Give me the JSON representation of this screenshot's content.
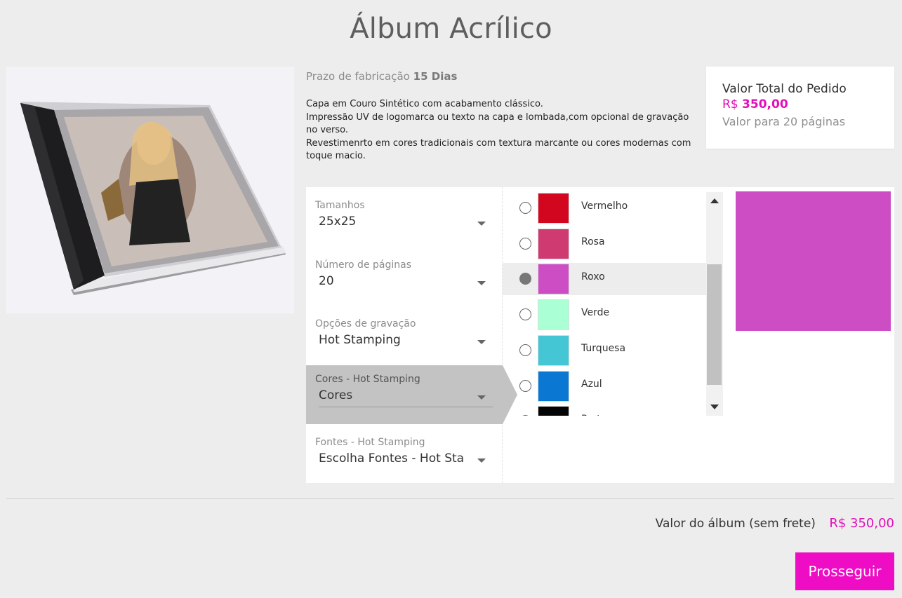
{
  "page": {
    "title": "Álbum Acrílico"
  },
  "info": {
    "prazo_label": "Prazo de fabricação",
    "prazo_value": "15 Dias",
    "description_lines": [
      "Capa em Couro Sintético com acabamento clássico.",
      "Impressão UV de logomarca ou texto na capa e lombada,com opcional de gravação no verso.",
      "Revestimenrto em cores tradicionais com textura marcante ou cores modernas com toque macio."
    ]
  },
  "total": {
    "label": "Valor Total do Pedido",
    "currency": "R$",
    "amount": "350,00",
    "sub": "Valor para 20 páginas"
  },
  "options": [
    {
      "label": "Tamanhos",
      "value": "25x25"
    },
    {
      "label": "Número de páginas",
      "value": "20"
    },
    {
      "label": "Opções de gravação",
      "value": "Hot Stamping"
    },
    {
      "label": "Cores - Hot Stamping",
      "value": "Cores"
    },
    {
      "label": "Fontes - Hot Stamping",
      "value": "Escolha Fontes - Hot Stamping"
    }
  ],
  "colors": [
    {
      "name": "Vermelho",
      "hex": "#d2061f",
      "selected": false
    },
    {
      "name": "Rosa",
      "hex": "#cf3a70",
      "selected": false
    },
    {
      "name": "Roxo",
      "hex": "#cd4dc5",
      "selected": true
    },
    {
      "name": "Verde",
      "hex": "#aaffd4",
      "selected": false
    },
    {
      "name": "Turquesa",
      "hex": "#45c6d4",
      "selected": false
    },
    {
      "name": "Azul",
      "hex": "#0a78d2",
      "selected": false
    },
    {
      "name": "Preto",
      "hex": "#050505",
      "selected": false
    }
  ],
  "preview_color": "#cd4dc5",
  "summary": {
    "label": "Valor do álbum (sem frete)",
    "price": "R$ 350,00"
  },
  "actions": {
    "continue_label": "Prosseguir"
  },
  "theme": {
    "accent": "#ee0cc4",
    "price_color": "#e20fb8"
  }
}
